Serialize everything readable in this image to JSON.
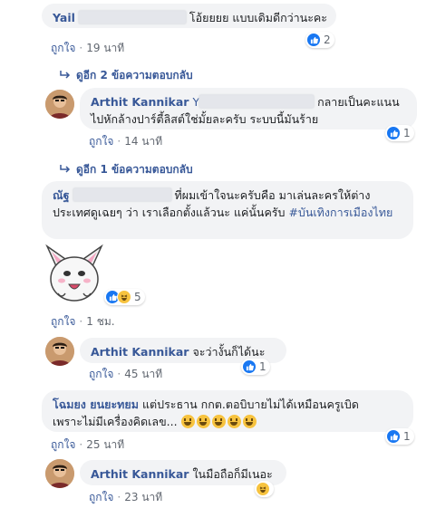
{
  "comments": [
    {
      "author": "Yail",
      "text": "โอ้ยยยย แบบเดิมดีกว่านะคะ",
      "like_label": "ถูกใจ",
      "time": "19 นาที",
      "reactions": "2"
    },
    {
      "author": "Arthit Kannikar",
      "mention": "Y",
      "text": "กลายเป็นคะแนนไปหักล้างปาร์ตี้ลิสต์ใช่มั้ยละครับ ระบบนี้มันร้าย",
      "like_label": "ถูกใจ",
      "time": "14 นาที",
      "reactions": "1"
    },
    {
      "author": "ณัฐ",
      "text": "ที่ผมเข้าใจนะครับคือ มาเล่นละครให้ต่างประเทศดูเฉยๆ ว่า เราเลือกตั้งแล้วนะ แค่นั้นครับ #บันเทิงการเมืองไทย",
      "like_label": "ถูกใจ",
      "time": "1 ชม.",
      "reactions": "5"
    },
    {
      "author": "Arthit Kannikar",
      "text": "จะว่างั้นก็ได้นะ",
      "like_label": "ถูกใจ",
      "time": "45 นาที",
      "reactions": "1"
    },
    {
      "author": "โฉมยง ยนยะทยม",
      "text": "แต่ประธาน กกต.ตอบิบายไม่ได้เหมือนครูเบิดเพราะไม่มีเครื่องคิดเลข...",
      "like_label": "ถูกใจ",
      "time": "25 นาที",
      "reactions": "1"
    },
    {
      "author": "Arthit Kannikar",
      "text": "ในมือถือก็มีเนอะ",
      "like_label": "ถูกใจ",
      "time": "23 นาที",
      "reactions": ""
    }
  ],
  "replies_links": [
    "ดูอีก 2 ข้อความตอบกลับ",
    "ดูอีก 1 ข้อความตอบกลับ"
  ],
  "colors": {
    "link": "#385898",
    "bubble": "#f2f3f5",
    "like": "#1877f2",
    "haha": "#f7c33f"
  }
}
